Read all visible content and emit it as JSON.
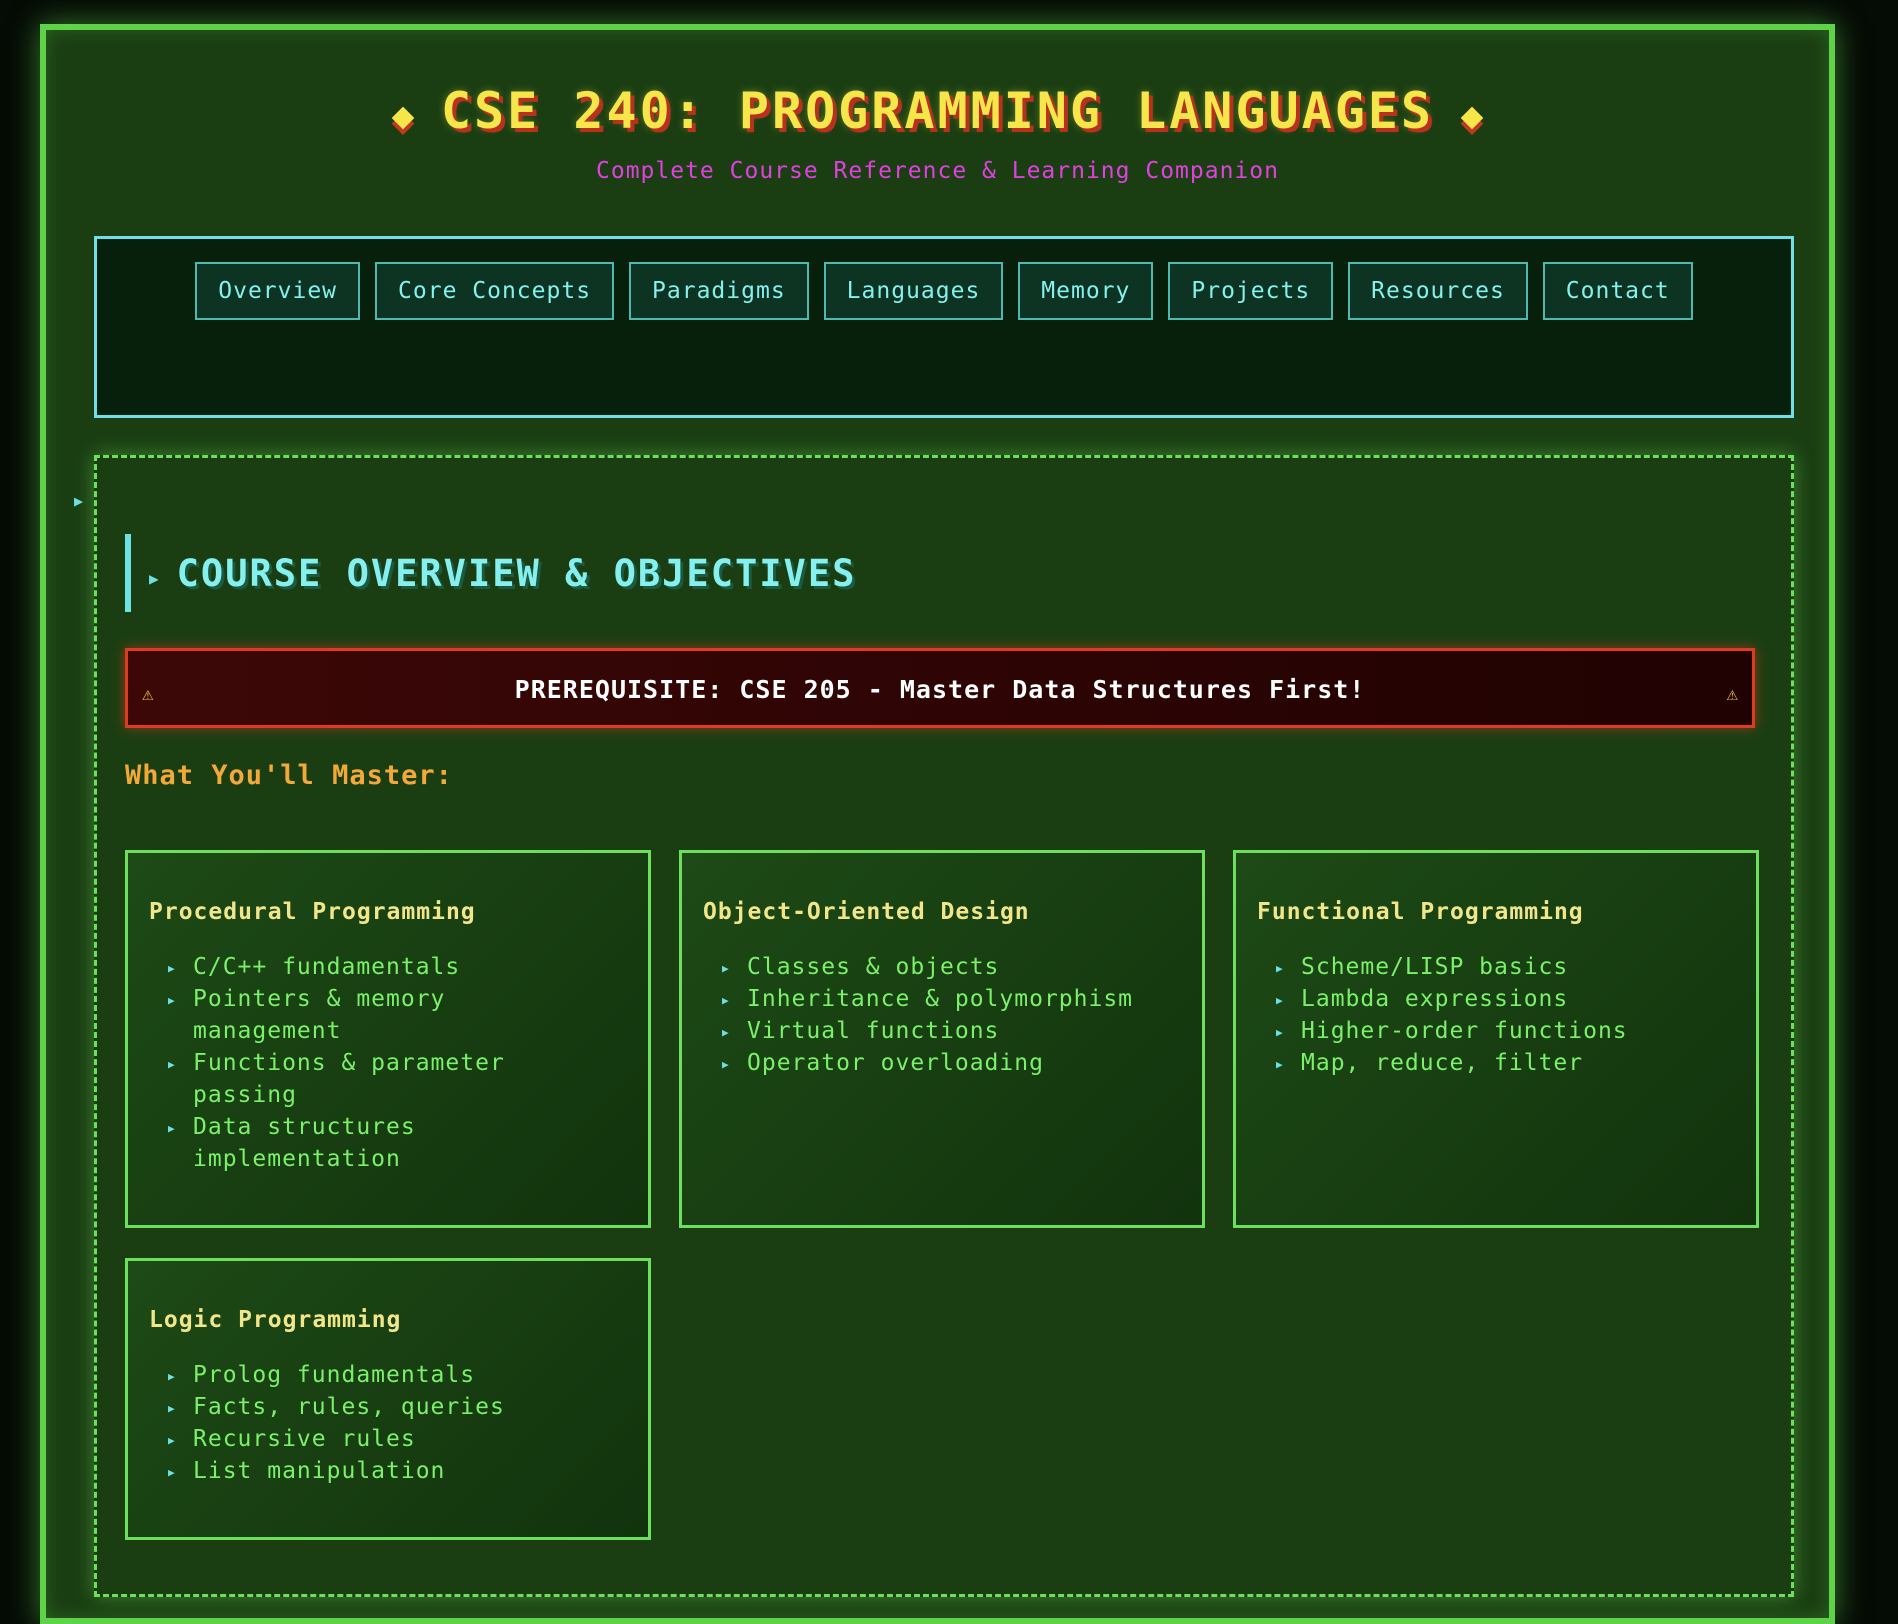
{
  "header": {
    "title": "CSE 240: PROGRAMMING LANGUAGES",
    "subtitle": "Complete Course Reference & Learning Companion"
  },
  "nav": {
    "items": [
      {
        "label": "Overview"
      },
      {
        "label": "Core Concepts"
      },
      {
        "label": "Paradigms"
      },
      {
        "label": "Languages"
      },
      {
        "label": "Memory"
      },
      {
        "label": "Projects"
      },
      {
        "label": "Resources"
      },
      {
        "label": "Contact"
      }
    ]
  },
  "section": {
    "title": "COURSE OVERVIEW & OBJECTIVES",
    "alert": "PREREQUISITE: CSE 205 - Master Data Structures First!",
    "warning_icon": "⚠",
    "master_heading": "What You'll Master:"
  },
  "cards": [
    {
      "title": "Procedural Programming",
      "items": [
        "C/C++ fundamentals",
        "Pointers & memory management",
        "Functions & parameter passing",
        "Data structures implementation"
      ]
    },
    {
      "title": "Object-Oriented Design",
      "items": [
        "Classes & objects",
        "Inheritance & polymorphism",
        "Virtual functions",
        "Operator overloading"
      ]
    },
    {
      "title": "Functional Programming",
      "items": [
        "Scheme/LISP basics",
        "Lambda expressions",
        "Higher-order functions",
        "Map, reduce, filter"
      ]
    },
    {
      "title": "Logic Programming",
      "items": [
        "Prolog fundamentals",
        "Facts, rules, queries",
        "Recursive rules",
        "List manipulation"
      ]
    }
  ],
  "colors": {
    "background": "#1a3e12",
    "frame_border": "#5ed34a",
    "title": "#f7e64a",
    "subtitle": "#e040e0",
    "nav_text": "#86f0ee",
    "alert_border": "#e23a22",
    "heading_orange": "#f3a83a",
    "list_text": "#7cf06a"
  }
}
